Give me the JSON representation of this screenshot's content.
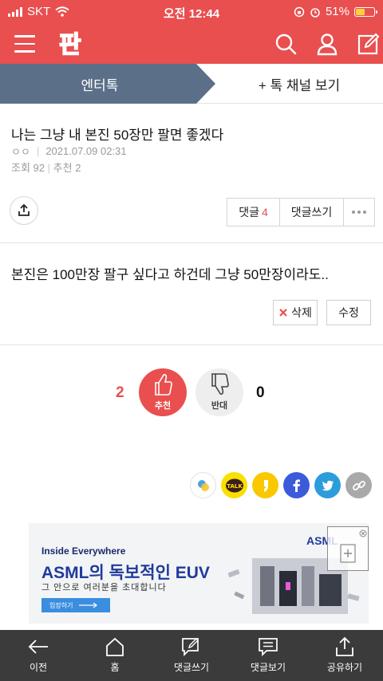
{
  "status_bar": {
    "carrier": "SKT",
    "time": "오전 12:44",
    "battery": "51%"
  },
  "colors": {
    "brand": "#e94f4f",
    "tab_active": "#5b6f89",
    "kakao": "#f9e000",
    "facebook": "#3b5bdb",
    "twitter": "#2d9cdb"
  },
  "app_bar": {
    "logo_text": "판",
    "icons": [
      "menu-icon",
      "search-icon",
      "user-icon",
      "edit-icon"
    ]
  },
  "tabs": {
    "active": "엔터톡",
    "other": "+ 톡 채널 보기"
  },
  "post": {
    "title": "나는 그냥 내 본진 50장만 팔면 좋겠다",
    "author": "ㅇㅇ",
    "date": "2021.07.09 02:31",
    "views_label": "조회",
    "views": "92",
    "recommend_label": "추천",
    "recommend": "2",
    "body": "본진은 100만장 팔구 싶다고 하건데 그냥 50만장이라도.."
  },
  "comments": {
    "label": "댓글",
    "count": "4",
    "write_label": "댓글쓰기"
  },
  "actions": {
    "delete_label": "삭제",
    "edit_label": "수정"
  },
  "votes": {
    "up_count": "2",
    "up_label": "추천",
    "down_label": "반대",
    "down_count": "0"
  },
  "share": {
    "icons": [
      "band-icon",
      "kakaotalk-icon",
      "kakaostory-icon",
      "facebook-icon",
      "twitter-icon",
      "link-icon"
    ],
    "talk_text": "TALK"
  },
  "ad": {
    "subtitle": "Inside Everywhere",
    "title": "ASML의 독보적인 EUV",
    "desc": "그 안으로 여러분을 초대합니다",
    "cta": "입장하기",
    "brand": "ASML"
  },
  "bottom_nav": [
    {
      "label": "이전",
      "icon": "back-arrow-icon"
    },
    {
      "label": "홈",
      "icon": "home-icon"
    },
    {
      "label": "댓글쓰기",
      "icon": "write-comment-icon"
    },
    {
      "label": "댓글보기",
      "icon": "view-comments-icon"
    },
    {
      "label": "공유하기",
      "icon": "share-icon"
    }
  ]
}
